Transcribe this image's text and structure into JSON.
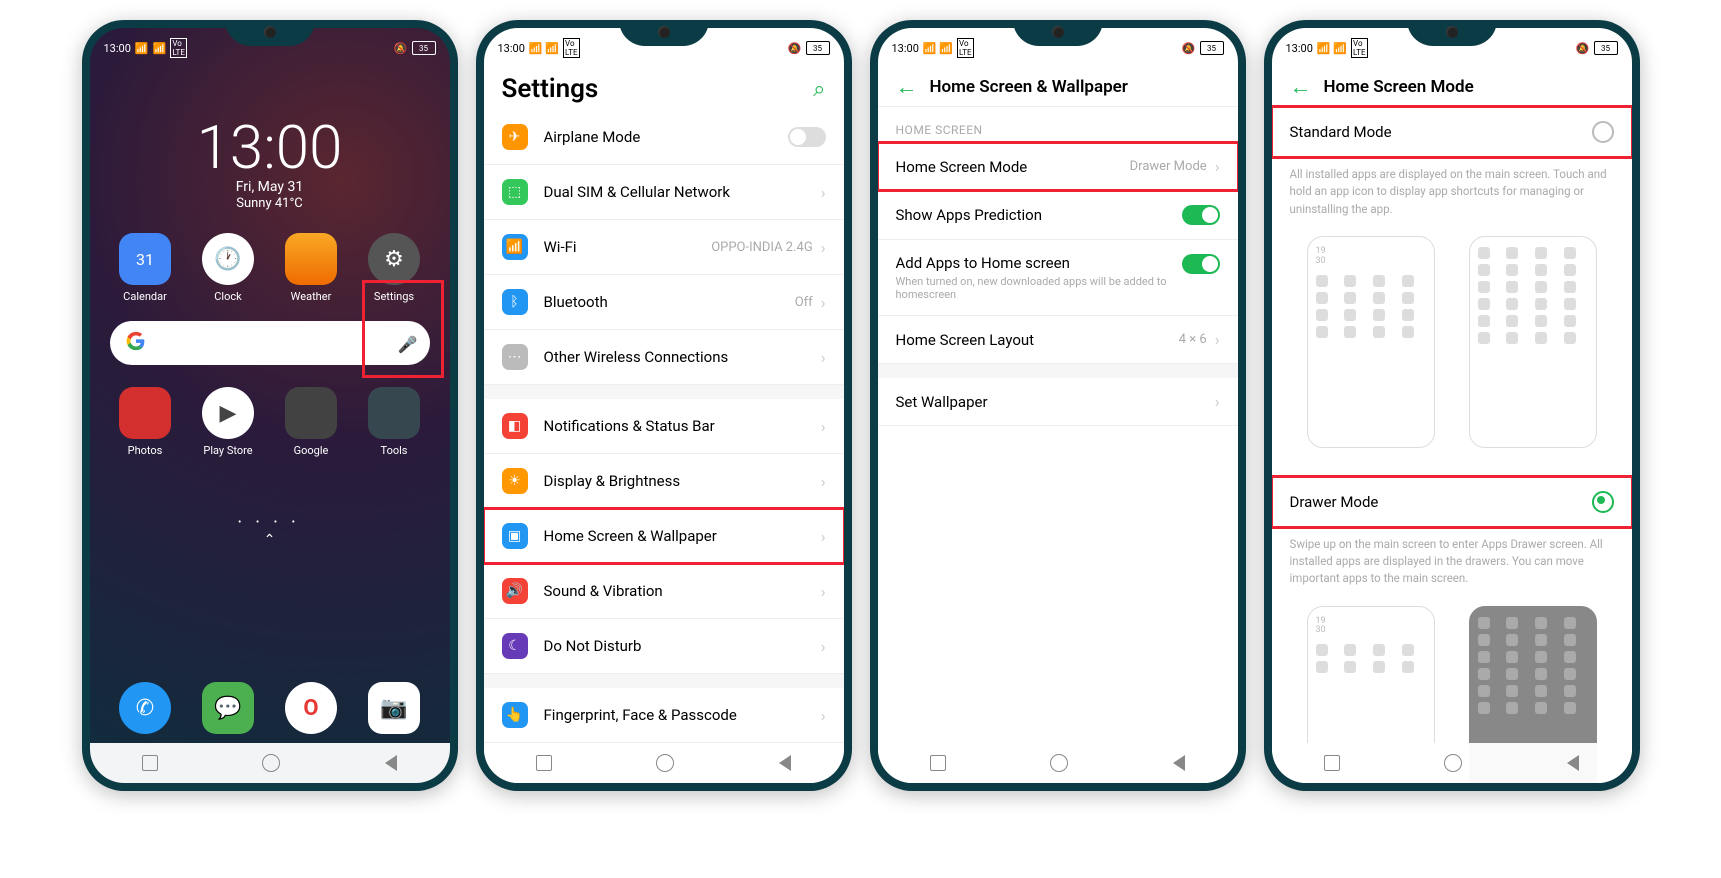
{
  "status": {
    "time": "13:00",
    "battery": "35"
  },
  "home": {
    "clock": "13:00",
    "date": "Fri, May 31",
    "weather": "Sunny 41°C",
    "apps_row1": [
      "Calendar",
      "Clock",
      "Weather",
      "Settings"
    ],
    "apps_row2": [
      "Photos",
      "Play Store",
      "Google",
      "Tools"
    ]
  },
  "settings": {
    "title": "Settings",
    "items": [
      {
        "label": "Airplane Mode",
        "icon": "#ff9500",
        "value": "toggle-off"
      },
      {
        "label": "Dual SIM & Cellular Network",
        "icon": "#34c759"
      },
      {
        "label": "Wi-Fi",
        "icon": "#2196f3",
        "value": "OPPO-INDIA 2.4G"
      },
      {
        "label": "Bluetooth",
        "icon": "#2196f3",
        "value": "Off"
      },
      {
        "label": "Other Wireless Connections",
        "icon": "#bbb"
      },
      {
        "gap": true
      },
      {
        "label": "Notifications & Status Bar",
        "icon": "#f44336"
      },
      {
        "label": "Display & Brightness",
        "icon": "#ff9800"
      },
      {
        "label": "Home Screen & Wallpaper",
        "icon": "#2196f3",
        "highlight": true
      },
      {
        "label": "Sound & Vibration",
        "icon": "#f44336"
      },
      {
        "label": "Do Not Disturb",
        "icon": "#673ab7"
      },
      {
        "gap": true
      },
      {
        "label": "Fingerprint, Face & Passcode",
        "icon": "#2196f3"
      }
    ]
  },
  "hswallpaper": {
    "title": "Home Screen & Wallpaper",
    "section": "HOME SCREEN",
    "items": [
      {
        "label": "Home Screen Mode",
        "value": "Drawer Mode",
        "highlight": true
      },
      {
        "label": "Show Apps Prediction",
        "toggle": "on"
      },
      {
        "label": "Add Apps to Home screen",
        "toggle": "on",
        "desc": "When turned on, new downloaded apps will be added to homescreen"
      },
      {
        "label": "Home Screen Layout",
        "value": "4 × 6"
      },
      {
        "gap": true
      },
      {
        "label": "Set Wallpaper"
      }
    ]
  },
  "hsmode": {
    "title": "Home Screen Mode",
    "standard": {
      "label": "Standard Mode",
      "desc": "All installed apps are displayed on the main screen. Touch and hold an app icon to display app shortcuts for managing or uninstalling the app."
    },
    "drawer": {
      "label": "Drawer Mode",
      "desc": "Swipe up on the main screen to enter Apps Drawer screen. All installed apps are displayed in the drawers. You can move important apps to the main screen."
    },
    "preview_time": "19\n30"
  }
}
